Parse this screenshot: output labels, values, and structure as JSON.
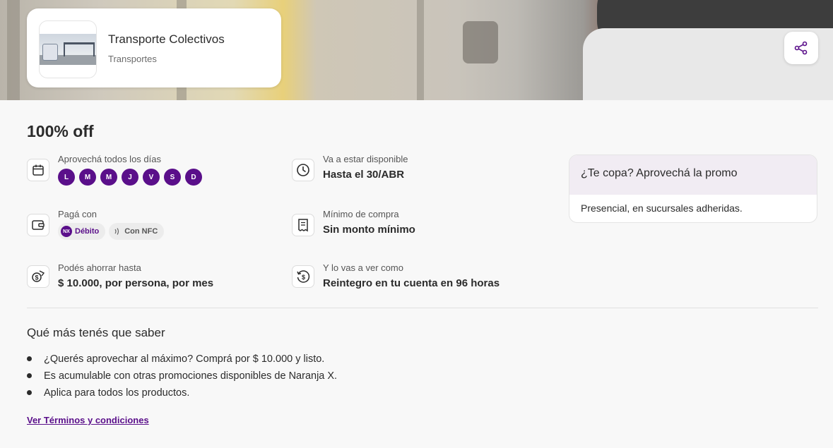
{
  "store": {
    "name": "Transporte Colectivos",
    "category": "Transportes"
  },
  "promo": {
    "title": "100% off",
    "days_label": "Aprovechá todos los días",
    "days": [
      "L",
      "M",
      "M",
      "J",
      "V",
      "S",
      "D"
    ],
    "available_label": "Va a estar disponible",
    "available_value": "Hasta el 30/ABR",
    "pay_label": "Pagá con",
    "pay_methods": {
      "debit": "Débito",
      "nx_logo": "NX",
      "nfc": "Con NFC"
    },
    "min_label": "Mínimo de compra",
    "min_value": "Sin monto mínimo",
    "save_label": "Podés ahorrar hasta",
    "save_value": "$ 10.000, por persona, por mes",
    "refund_label": "Y lo vas a ver como",
    "refund_value": "Reintegro en tu cuenta en 96 horas"
  },
  "promo_card": {
    "header": "¿Te copa? Aprovechá la promo",
    "body": "Presencial, en sucursales adheridas."
  },
  "more": {
    "title": "Qué más tenés que saber",
    "items": [
      "¿Querés aprovechar al máximo? Comprá por $ 10.000 y listo.",
      "Es acumulable con otras promociones disponibles de Naranja X.",
      "Aplica para todos los productos."
    ],
    "terms_link": "Ver Términos y condiciones"
  },
  "colors": {
    "brand": "#5a0f8a",
    "card_header": "#f1ecf3",
    "text": "#2b2b2b"
  },
  "icons": [
    "share-icon",
    "calendar-icon",
    "clock-icon",
    "wallet-icon",
    "receipt-icon",
    "money-icon",
    "refund-icon",
    "nfc-icon"
  ]
}
